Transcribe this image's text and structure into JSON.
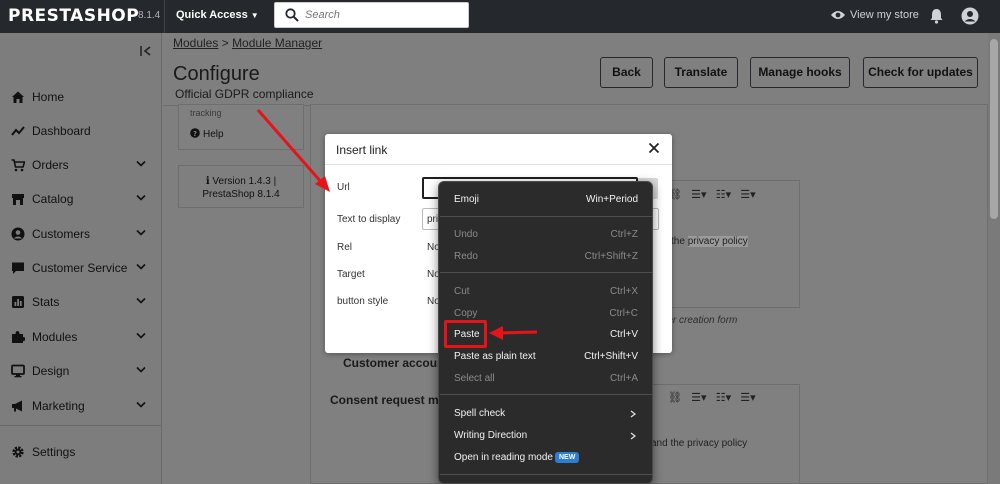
{
  "topbar": {
    "logo": "PRESTASHOP",
    "version": "8.1.4",
    "quick_access": "Quick Access",
    "search_placeholder": "Search",
    "view_store": "View my store"
  },
  "sidebar": {
    "items": [
      {
        "label": "Home",
        "icon": "home-icon",
        "chevron": false
      },
      {
        "label": "Dashboard",
        "icon": "chart-line-icon",
        "chevron": false
      },
      {
        "label": "Orders",
        "icon": "cart-icon",
        "chevron": true
      },
      {
        "label": "Catalog",
        "icon": "store-icon",
        "chevron": true
      },
      {
        "label": "Customers",
        "icon": "person-circle-icon",
        "chevron": true
      },
      {
        "label": "Customer Service",
        "icon": "chat-icon",
        "chevron": true
      },
      {
        "label": "Stats",
        "icon": "bar-chart-icon",
        "chevron": true
      },
      {
        "label": "Modules",
        "icon": "puzzle-icon",
        "chevron": true
      },
      {
        "label": "Design",
        "icon": "monitor-icon",
        "chevron": true
      },
      {
        "label": "Marketing",
        "icon": "megaphone-icon",
        "chevron": true
      }
    ],
    "settings": "Settings"
  },
  "header": {
    "breadcrumb": [
      "Modules",
      "Module Manager"
    ],
    "breadcrumb_sep": ">",
    "title": "Configure",
    "subtitle": "Official GDPR compliance",
    "buttons": [
      "Back",
      "Translate",
      "Manage hooks",
      "Check for updates"
    ]
  },
  "left_panel": {
    "tracking": "tracking",
    "help": "Help",
    "version_line1": "Version 1.4.3 |",
    "version_line2": "PrestaShop 8.1.4"
  },
  "content": {
    "editor_text_top": "the privacy policy",
    "editor_text_top_highlight": "privacy policy",
    "hint_top": "mer creation form",
    "customer_account_label": "Customer account a",
    "consent_label": "Consent request mess",
    "editor_text_bottom": "and the privacy policy"
  },
  "modal": {
    "title": "Insert link",
    "fields": [
      {
        "label": "Url",
        "value": ""
      },
      {
        "label": "Text to display",
        "value": "pri"
      },
      {
        "label": "Rel",
        "value": "No"
      },
      {
        "label": "Target",
        "value": "No"
      },
      {
        "label": "button style",
        "value": "No"
      }
    ],
    "cancel_fragment": "el"
  },
  "context_menu": {
    "groups": [
      [
        {
          "label": "Emoji",
          "shortcut": "Win+Period",
          "disabled": false
        }
      ],
      [
        {
          "label": "Undo",
          "shortcut": "Ctrl+Z",
          "disabled": true
        },
        {
          "label": "Redo",
          "shortcut": "Ctrl+Shift+Z",
          "disabled": true
        }
      ],
      [
        {
          "label": "Cut",
          "shortcut": "Ctrl+X",
          "disabled": true
        },
        {
          "label": "Copy",
          "shortcut": "Ctrl+C",
          "disabled": true
        },
        {
          "label": "Paste",
          "shortcut": "Ctrl+V",
          "disabled": false
        },
        {
          "label": "Paste as plain text",
          "shortcut": "Ctrl+Shift+V",
          "disabled": false
        },
        {
          "label": "Select all",
          "shortcut": "Ctrl+A",
          "disabled": true
        }
      ],
      [
        {
          "label": "Spell check",
          "submenu": true
        },
        {
          "label": "Writing Direction",
          "submenu": true
        },
        {
          "label": "Open in reading mode",
          "badge": "NEW"
        }
      ]
    ]
  },
  "colors": {
    "topbar_bg": "#25282c",
    "overlay_gray": "#7f7f7f",
    "menu_bg": "#2b2b2b",
    "annotation_red": "#e4141a",
    "badge_blue": "#2d7dd2"
  }
}
